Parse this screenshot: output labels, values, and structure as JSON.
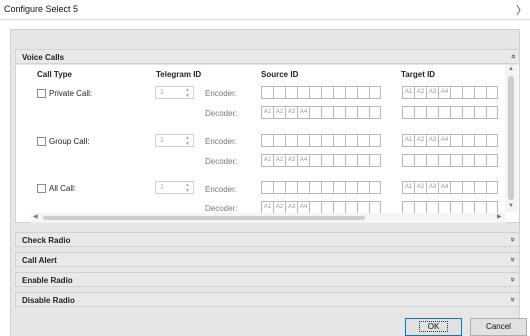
{
  "window": {
    "title": "Configure Select 5",
    "close_glyph": "〉"
  },
  "sections": [
    {
      "label": "Voice Calls",
      "chevron": "»"
    },
    {
      "label": "Check Radio",
      "chevron": "»"
    },
    {
      "label": "Call Alert",
      "chevron": "»"
    },
    {
      "label": "Enable Radio",
      "chevron": "»"
    },
    {
      "label": "Disable Radio",
      "chevron": "»"
    }
  ],
  "columns": {
    "call_type": "Call Type",
    "telegram_id": "Telegram ID",
    "source_id": "Source ID",
    "target_id": "Target ID"
  },
  "rows": [
    {
      "label": "Private Call:",
      "checked": false,
      "telegram": "1",
      "encoder": "Encoder:",
      "decoder": "Decoder:"
    },
    {
      "label": "Group Call:",
      "checked": false,
      "telegram": "1",
      "encoder": "Encoder:",
      "decoder": "Decoder:"
    },
    {
      "label": "All Call:",
      "checked": false,
      "telegram": "1",
      "encoder": "Encoder:",
      "decoder": "Decoder:"
    }
  ],
  "byte_prefix": [
    "A1",
    "A2",
    "A3",
    "A4"
  ],
  "buttons": {
    "ok": "OK",
    "cancel": "Cancel"
  }
}
